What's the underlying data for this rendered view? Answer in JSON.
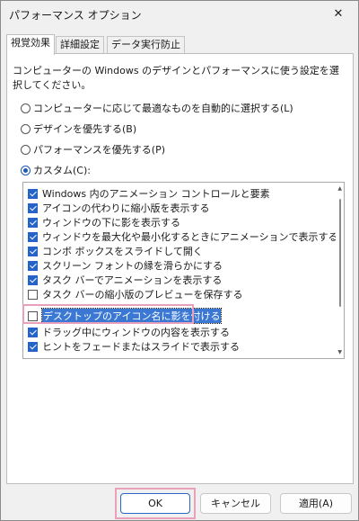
{
  "window": {
    "title": "パフォーマンス オプション",
    "close_glyph": "✕"
  },
  "tabs": [
    {
      "label": "視覚効果",
      "active": true
    },
    {
      "label": "詳細設定",
      "active": false
    },
    {
      "label": "データ実行防止",
      "active": false
    }
  ],
  "description": "コンピューターの Windows のデザインとパフォーマンスに使う設定を選択してください。",
  "radios": [
    {
      "label": "コンピューターに応じて最適なものを自動的に選択する(L)",
      "selected": false
    },
    {
      "label": "デザインを優先する(B)",
      "selected": false
    },
    {
      "label": "パフォーマンスを優先する(P)",
      "selected": false
    },
    {
      "label": "カスタム(C):",
      "selected": true
    }
  ],
  "effects": [
    {
      "label": "Windows 内のアニメーション コントロールと要素",
      "checked": true
    },
    {
      "label": "アイコンの代わりに縮小版を表示する",
      "checked": true
    },
    {
      "label": "ウィンドウの下に影を表示する",
      "checked": true
    },
    {
      "label": "ウィンドウを最大化や最小化するときにアニメーションで表示する",
      "checked": true
    },
    {
      "label": "コンボ ボックスをスライドして開く",
      "checked": true
    },
    {
      "label": "スクリーン フォントの縁を滑らかにする",
      "checked": true
    },
    {
      "label": "タスク バーでアニメーションを表示する",
      "checked": true
    },
    {
      "label": "タスク バーの縮小版のプレビューを保存する",
      "checked": false
    },
    {
      "label": "デスクトップのアイコン名に影を付ける",
      "checked": false,
      "highlighted": true
    },
    {
      "label": "ドラッグ中にウィンドウの内容を表示する",
      "checked": true
    },
    {
      "label": "ヒントをフェードまたはスライドで表示する",
      "checked": true
    }
  ],
  "buttons": {
    "ok": "OK",
    "cancel": "キャンセル",
    "apply": "適用(A)"
  },
  "colors": {
    "accent": "#2463c8",
    "selection": "#3a78d4",
    "annotation": "#e9a0bb"
  }
}
